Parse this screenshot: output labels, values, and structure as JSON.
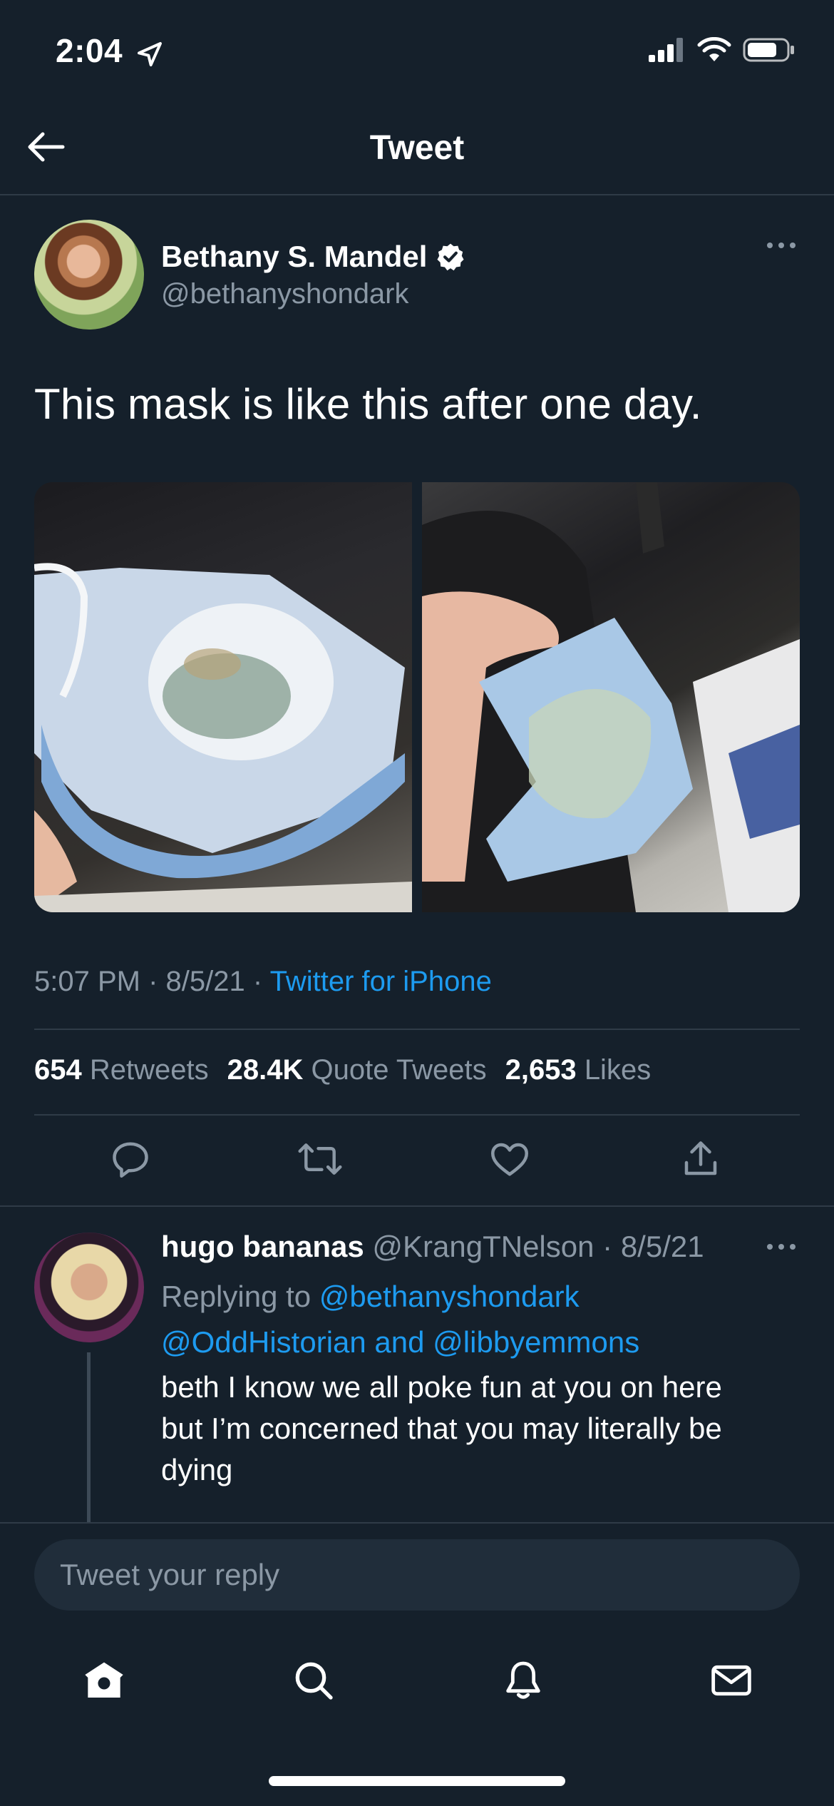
{
  "status_bar": {
    "time": "2:04"
  },
  "header": {
    "title": "Tweet"
  },
  "tweet": {
    "author_name": "Bethany S. Mandel",
    "author_handle": "@bethanyshondark",
    "text": "This mask is like this after one day.",
    "time": "5:07 PM",
    "date": "8/5/21",
    "source": "Twitter for iPhone",
    "stats": {
      "retweets_count": "654",
      "retweets_label": "Retweets",
      "quotes_count": "28.4K",
      "quotes_label": "Quote Tweets",
      "likes_count": "2,653",
      "likes_label": "Likes"
    }
  },
  "reply": {
    "name": "hugo bananas",
    "handle": "@KrangTNelson",
    "date": "8/5/21",
    "replying_prefix": "Replying to",
    "replying_to_1": "@bethanyshondark",
    "replying_to_2": "@OddHistorian",
    "and_word": "and",
    "replying_to_3": "@libbyemmons",
    "text_lines": [
      "beth I know we all poke fun at you on here",
      "but I’m concerned that you may literally be",
      "dying"
    ]
  },
  "composer": {
    "placeholder": "Tweet your reply"
  },
  "colors": {
    "background": "#15202b",
    "accent": "#1d9bf0",
    "muted": "#8b98a5"
  },
  "icons": {
    "back": "back-arrow-icon",
    "verified": "verified-badge-icon",
    "more": "more-icon",
    "reply": "reply-icon",
    "retweet": "retweet-icon",
    "like": "like-icon",
    "share": "share-icon",
    "home": "home-icon",
    "search": "search-icon",
    "notifications": "bell-icon",
    "messages": "mail-icon"
  }
}
